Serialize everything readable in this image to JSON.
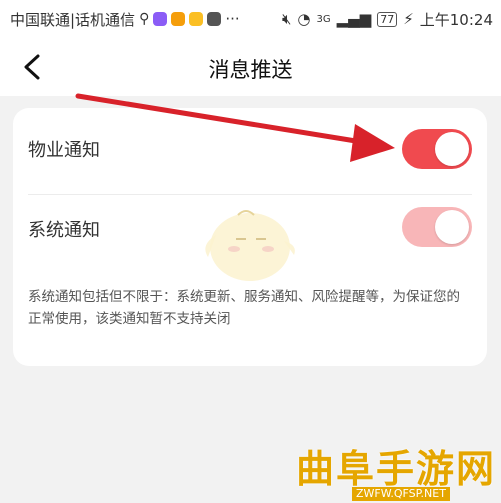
{
  "status_bar": {
    "carrier": "中国联通|话机通信",
    "time": "上午10:24",
    "battery": "77",
    "network": "3G",
    "icons": [
      "usb-icon",
      "app-icon",
      "video-app-icon",
      "orange-app-icon",
      "mail-app-icon",
      "more-icon",
      "mute-icon",
      "wifi-icon",
      "signal-icon",
      "charging-icon"
    ]
  },
  "header": {
    "title": "消息推送",
    "back_icon": "chevron-left-icon"
  },
  "settings": {
    "items": [
      {
        "label": "物业通知",
        "enabled": true,
        "color": "#f04a4f"
      },
      {
        "label": "系统通知",
        "enabled": true,
        "disabled": true,
        "color": "#f8b6b8"
      }
    ],
    "description": "系统通知包括但不限于：系统更新、服务通知、风险提醒等，为保证您的正常使用，该类通知暂不支持关闭"
  },
  "watermark": {
    "text": "曲阜手游网",
    "url": "ZWFW.QFSP.NET",
    "color": "#e5a600"
  },
  "annotation_arrow_color": "#d8222a"
}
